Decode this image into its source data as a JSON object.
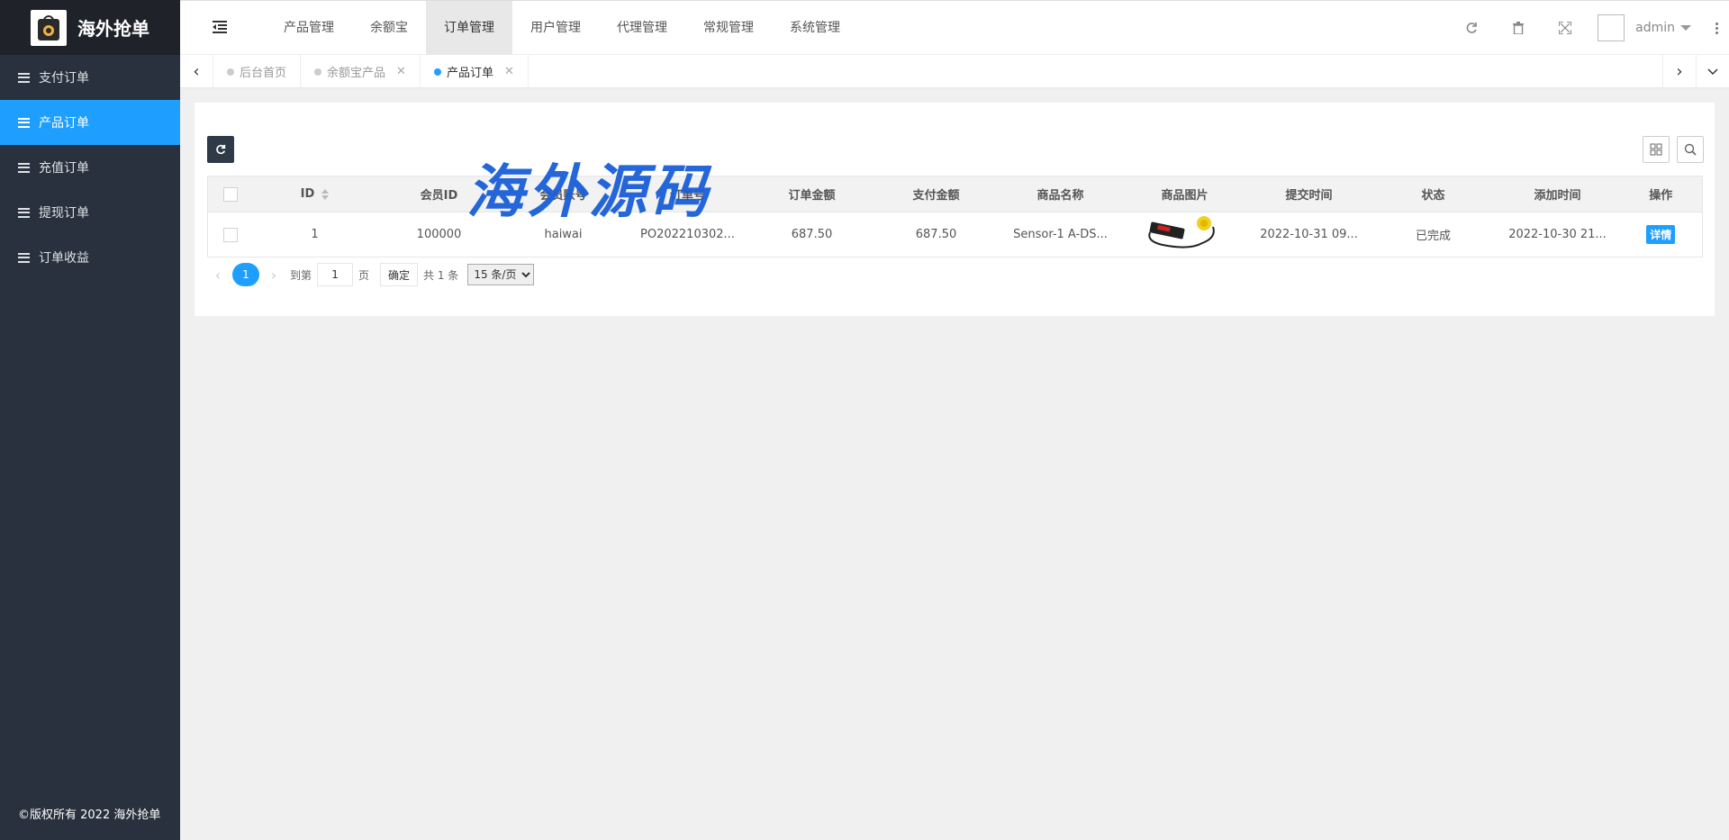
{
  "brand": {
    "title": "海外抢单"
  },
  "sidebar": {
    "items": [
      {
        "label": "支付订单",
        "active": false
      },
      {
        "label": "产品订单",
        "active": true
      },
      {
        "label": "充值订单",
        "active": false
      },
      {
        "label": "提现订单",
        "active": false
      },
      {
        "label": "订单收益",
        "active": false
      }
    ],
    "copyright": "©版权所有 2022 海外抢单"
  },
  "header": {
    "nav": [
      {
        "label": "产品管理"
      },
      {
        "label": "余额宝"
      },
      {
        "label": "订单管理",
        "active": true
      },
      {
        "label": "用户管理"
      },
      {
        "label": "代理管理"
      },
      {
        "label": "常规管理"
      },
      {
        "label": "系统管理"
      }
    ],
    "user": "admin"
  },
  "tabs": [
    {
      "label": "后台首页"
    },
    {
      "label": "余额宝产品"
    },
    {
      "label": "产品订单",
      "active": true
    }
  ],
  "table": {
    "columns": [
      "ID",
      "会员ID",
      "会员账号",
      "订单号",
      "订单金额",
      "支付金额",
      "商品名称",
      "商品图片",
      "提交时间",
      "状态",
      "添加时间",
      "操作"
    ],
    "rows": [
      {
        "id": "1",
        "member_id": "100000",
        "member_account": "haiwai",
        "order_no": "PO202210302...",
        "order_amount": "687.50",
        "pay_amount": "687.50",
        "product_name": "Sensor-1 A-DS...",
        "submit_time": "2022-10-31 09...",
        "status": "已完成",
        "add_time": "2022-10-30 21...",
        "action": "详情"
      }
    ]
  },
  "pager": {
    "current": "1",
    "goto_label": "到第",
    "goto_value": "1",
    "page_unit": "页",
    "confirm": "确定",
    "total": "共 1 条",
    "page_size": "15 条/页"
  },
  "watermark": "海外源码",
  "colors": {
    "primary": "#1e9fff",
    "sidebar": "#28313d",
    "logo_bg": "#20222a"
  }
}
